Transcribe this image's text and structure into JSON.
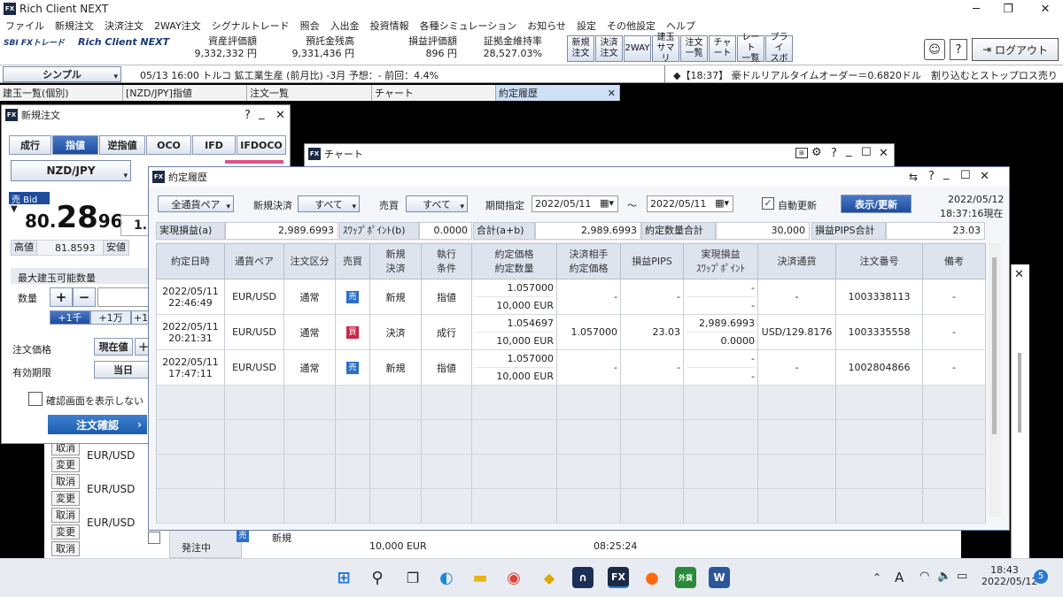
{
  "app": {
    "title": "Rich Client NEXT"
  },
  "menu": [
    "ファイル",
    "新規注文",
    "決済注文",
    "2WAY注文",
    "シグナルトレード",
    "照会",
    "入出金",
    "投資情報",
    "各種シミュレーション",
    "お知らせ",
    "設定",
    "その他設定",
    "ヘルプ"
  ],
  "toolbar": {
    "logo_text": "SBI FXトレード",
    "logo_sub": "Rich Client NEXT",
    "stats": [
      {
        "label": "資産評価額",
        "value": "9,332,332 円"
      },
      {
        "label": "預託金残高",
        "value": "9,331,436 円"
      },
      {
        "label": "損益評価額",
        "value": "896 円"
      },
      {
        "label": "証拠金維持率",
        "value": "28,527.03%"
      }
    ],
    "buttons": [
      "新規\n注文",
      "決済\n注文",
      "2WAY",
      "建玉\nサマリ",
      "注文\n一覧",
      "チャ\nート",
      "レート\n一覧",
      "プライ\nスボ"
    ],
    "logout_label": "ログアウト",
    "help": "?"
  },
  "ticker": {
    "mode": "シンプル",
    "news": "05/13 16:00 トルコ 鉱工業生産 (前月比) -3月 予想：- 前回：4.4%",
    "alert": "◆【18:37】 豪ドルリアルタイムオーダー＝0.6820ドル　割り込むとストップロス売り"
  },
  "tabs": [
    {
      "label": "建玉一覧(個別)"
    },
    {
      "label": "[NZD/JPY]指値"
    },
    {
      "label": "注文一覧"
    },
    {
      "label": "チャート"
    },
    {
      "label": "約定履歴"
    }
  ],
  "new_order": {
    "title": "新規注文",
    "order_types": [
      "成行",
      "指値",
      "逆指値",
      "OCO",
      "IFD",
      "IFDOCO"
    ],
    "pair": "NZD/JPY",
    "side_label": "売 Bid",
    "rate_prefix": "80.",
    "rate_big": "28",
    "rate_small": "96",
    "rate_right": "1.",
    "high_label": "高値",
    "high_value": "81.8593",
    "low_label": "安値",
    "max_label": "最大建玉可能数量",
    "qty_label": "数量",
    "plus": "+",
    "minus": "−",
    "qty_btns": [
      "+1千",
      "+1万",
      "+1"
    ],
    "price_label": "注文価格",
    "price_btn": "現在値",
    "expiry_label": "有効期限",
    "expiry_btn": "当日",
    "confirm_label": "確認画面を表示しない",
    "submit_label": "注文確認"
  },
  "chart_win": {
    "title": "チャート"
  },
  "bg_orders": {
    "rows": [
      {
        "a": "取消",
        "b": ""
      },
      {
        "a": "変更",
        "b": "EUR/USD"
      },
      {
        "a": "取消",
        "b": ""
      },
      {
        "a": "変更",
        "b": "EUR/USD"
      },
      {
        "a": "取消",
        "b": ""
      },
      {
        "a": "変更",
        "b": "EUR/USD"
      },
      {
        "a": "取消",
        "b": ""
      }
    ],
    "side": "売",
    "kind": "新規",
    "status": "発注中",
    "qty": "10,000 EUR",
    "time": "08:25:24"
  },
  "history": {
    "title": "約定履歴",
    "filters": {
      "pair": "全通貨ペア",
      "new_close_label": "新規決済",
      "new_close": "すべて",
      "side_label": "売買",
      "side": "すべて",
      "period_label": "期間指定",
      "from": "2022/05/11",
      "tilde": "～",
      "to": "2022/05/11",
      "auto_label": "自動更新",
      "refresh": "表示/更新",
      "as_of_date": "2022/05/12",
      "as_of_time": "18:37:16現在"
    },
    "summary": [
      {
        "label": "実現損益(a)",
        "value": "2,989.6993"
      },
      {
        "label": "ｽﾜｯﾌﾟﾎﾟｲﾝﾄ(b)",
        "value": "0.0000"
      },
      {
        "label": "合計(a+b)",
        "value": "2,989.6993"
      },
      {
        "label": "約定数量合計",
        "value": "30,000"
      },
      {
        "label": "損益PIPS合計",
        "value": "23.03"
      }
    ],
    "columns": [
      "約定日時",
      "通貨ペア",
      "注文区分",
      "売買",
      "新規\n決済",
      "執行\n条件",
      "約定価格\n約定数量",
      "決済相手\n約定価格",
      "損益PIPS",
      "実現損益\nｽﾜｯﾌﾟﾎﾟｲﾝﾄ",
      "決済通貨",
      "注文番号",
      "備考"
    ],
    "rows": [
      {
        "date": "2022/05/11",
        "time": "22:46:49",
        "pair": "EUR/USD",
        "type": "通常",
        "side": "売",
        "side_kind": "sell",
        "nc": "新規",
        "cond": "指値",
        "price": "1.057000",
        "qty": "10,000 EUR",
        "cp": "-",
        "pips": "-",
        "pl": "-",
        "swap": "-",
        "ccy": "-",
        "no": "1003338113",
        "note": "-"
      },
      {
        "date": "2022/05/11",
        "time": "20:21:31",
        "pair": "EUR/USD",
        "type": "通常",
        "side": "買",
        "side_kind": "buy",
        "nc": "決済",
        "cond": "成行",
        "price": "1.054697",
        "qty": "10,000 EUR",
        "cp": "1.057000",
        "pips": "23.03",
        "pl": "2,989.6993",
        "swap": "0.0000",
        "ccy": "USD/129.8176",
        "no": "1003335558",
        "note": "-"
      },
      {
        "date": "2022/05/11",
        "time": "17:47:11",
        "pair": "EUR/USD",
        "type": "通常",
        "side": "売",
        "side_kind": "sell",
        "nc": "新規",
        "cond": "指値",
        "price": "1.057000",
        "qty": "10,000 EUR",
        "cp": "-",
        "pips": "-",
        "pl": "-",
        "swap": "-",
        "ccy": "-",
        "no": "1002804866",
        "note": "-"
      }
    ]
  },
  "taskbar": {
    "time": "18:43",
    "date": "2022/05/12",
    "ime": "A",
    "badge": "5"
  },
  "colors": {
    "accent": "#1d4c9c",
    "sell": "#2b6fc7",
    "buy": "#c8284a",
    "header": "#dde4ee"
  }
}
